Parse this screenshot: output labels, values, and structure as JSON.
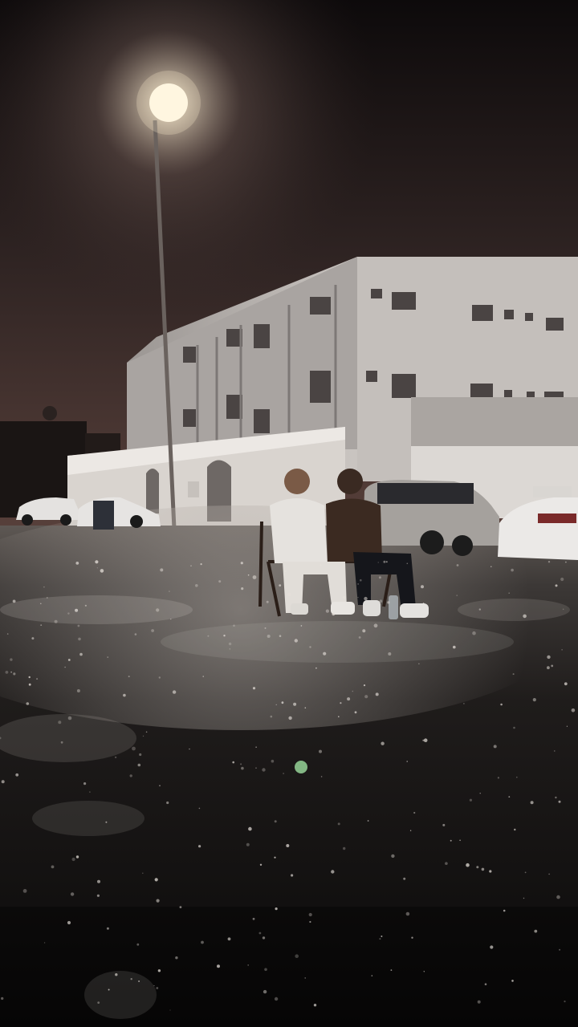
{
  "scene": {
    "kind": "photo",
    "description_tokens": [
      "night",
      "rain",
      "street-lamp",
      "building",
      "parked-cars",
      "two-people-on-bench",
      "wet-road"
    ],
    "colors": {
      "sky_top": "#120e0e",
      "sky_glow": "#4a3734",
      "sky_bottom": "#5c423c",
      "building_light": "#cfcac6",
      "building_shadow": "#8f8a87",
      "wall": "#d9d4d0",
      "road_dark": "#0e0c0c",
      "road_wet": "#6b6460",
      "lamp": "#fff6e0",
      "suv": "#a8a4a0",
      "car_white": "#e8e6e4",
      "shirt_white": "#e6e3df",
      "jacket_brown": "#3a2a22",
      "jeans_dark": "#15161b"
    }
  }
}
